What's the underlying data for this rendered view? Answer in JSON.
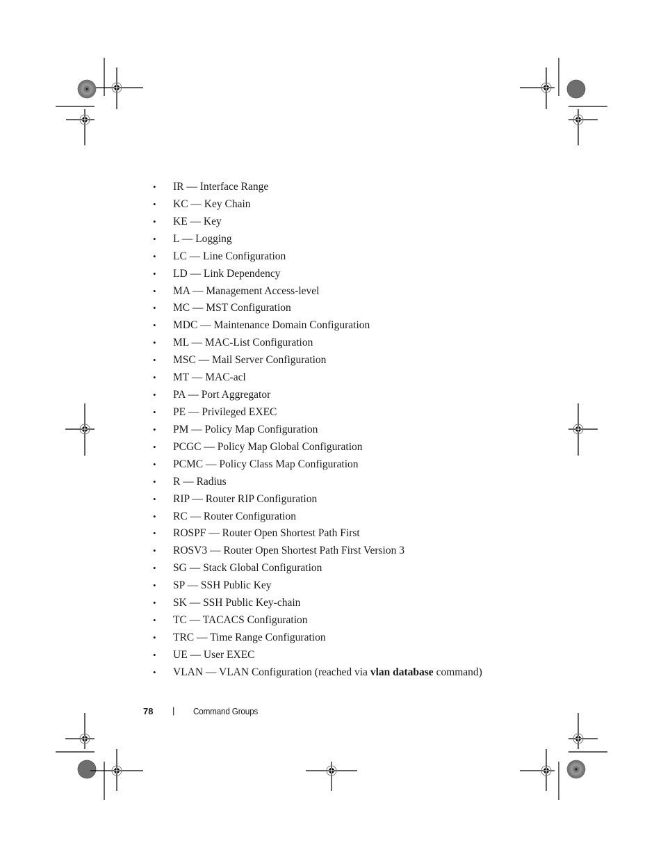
{
  "list": {
    "items": [
      {
        "text": "IR — Interface Range"
      },
      {
        "text": "KC — Key Chain"
      },
      {
        "text": "KE — Key"
      },
      {
        "text": "L — Logging"
      },
      {
        "text": "LC — Line Configuration"
      },
      {
        "text": "LD — Link Dependency"
      },
      {
        "text": "MA — Management Access-level"
      },
      {
        "text": "MC — MST Configuration"
      },
      {
        "text": "MDC — Maintenance Domain Configuration"
      },
      {
        "text": "ML — MAC-List Configuration"
      },
      {
        "text": "MSC — Mail Server Configuration"
      },
      {
        "text": "MT — MAC-acl"
      },
      {
        "text": "PA — Port Aggregator"
      },
      {
        "text": "PE — Privileged EXEC"
      },
      {
        "text": "PM — Policy Map Configuration"
      },
      {
        "text": "PCGC — Policy Map Global Configuration"
      },
      {
        "text": "PCMC — Policy Class Map Configuration"
      },
      {
        "text": "R — Radius"
      },
      {
        "text": "RIP — Router RIP Configuration"
      },
      {
        "text": "RC — Router Configuration"
      },
      {
        "text": "ROSPF — Router Open Shortest Path First"
      },
      {
        "text": "ROSV3 — Router Open Shortest Path First Version 3"
      },
      {
        "text": "SG — Stack Global Configuration"
      },
      {
        "text": "SP — SSH Public Key"
      },
      {
        "text": "SK — SSH Public Key-chain"
      },
      {
        "text": "TC — TACACS Configuration"
      },
      {
        "text": "TRC — Time Range Configuration"
      },
      {
        "text": "UE — User EXEC"
      }
    ],
    "last_item": {
      "prefix": "VLAN — VLAN Configuration (reached via ",
      "bold": "vlan database",
      "suffix": " command)"
    },
    "bullet": "•"
  },
  "footer": {
    "page_number": "78",
    "separator": "|",
    "section_title": "Command Groups"
  },
  "icons": {
    "registration_mark": "crosshair-target",
    "color_wheel": "starburst-circle"
  }
}
